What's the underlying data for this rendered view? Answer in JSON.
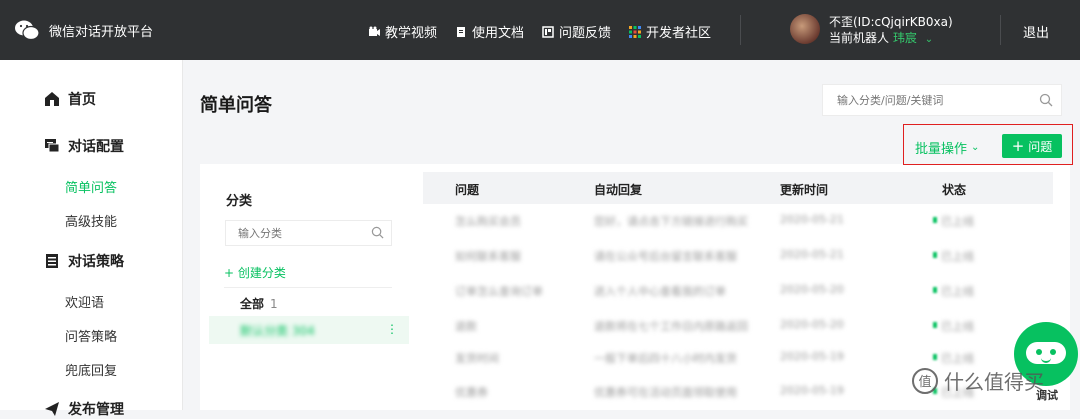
{
  "header": {
    "title": "微信对话开放平台",
    "nav": [
      {
        "label": "教学视频",
        "icon": "video-icon"
      },
      {
        "label": "使用文档",
        "icon": "doc-icon"
      },
      {
        "label": "问题反馈",
        "icon": "feedback-icon"
      },
      {
        "label": "开发者社区",
        "icon": "community-icon"
      }
    ],
    "user": {
      "name": "不歪(ID:cQjqirKB0xa)",
      "robot_label": "当前机器人",
      "robot_name": "玮宸"
    },
    "logout": "退出"
  },
  "sidebar": {
    "home": "首页",
    "dialog_config": "对话配置",
    "dialog_config_items": [
      "简单问答",
      "高级技能"
    ],
    "dialog_strategy": "对话策略",
    "dialog_strategy_items": [
      "欢迎语",
      "问答策略",
      "兜底回复"
    ],
    "publish": "发布管理",
    "active": "简单问答"
  },
  "main": {
    "title": "简单问答",
    "search_placeholder": "输入分类/问题/关键词",
    "batch_label": "批量操作",
    "add_label": "问题"
  },
  "category": {
    "title": "分类",
    "search_placeholder": "输入分类",
    "create_label": "创建分类",
    "all_label": "全部",
    "all_count": "1",
    "selected_label": "默认分类  304"
  },
  "table": {
    "columns": [
      "问题",
      "自动回复",
      "更新时间",
      "状态"
    ],
    "rows": [
      {
        "question": "怎么购买会员",
        "reply": "您好，请点击下方链接进行购买",
        "time": "2020-05-21",
        "status": "已上线"
      },
      {
        "question": "如何联系客服",
        "reply": "请在公众号后台留言联系客服",
        "time": "2020-05-21",
        "status": "已上线"
      },
      {
        "question": "订单怎么查询订单",
        "reply": "进入个人中心查看我的订单",
        "time": "2020-05-20",
        "status": "已上线"
      },
      {
        "question": "退款",
        "reply": "退款将在七个工作日内原路返回",
        "time": "2020-05-20",
        "status": "已上线"
      },
      {
        "question": "发货时间",
        "reply": "一般下单后四十八小时内发货",
        "time": "2020-05-19",
        "status": "已上线"
      },
      {
        "question": "优惠券",
        "reply": "优惠券可在活动页面领取使用",
        "time": "2020-05-19",
        "status": "已上线"
      }
    ]
  },
  "watermark": "什么值得买",
  "debug_label": "调试",
  "colors": {
    "accent": "#07c160",
    "header_bg": "#2f3133",
    "highlight": "#e02020"
  }
}
